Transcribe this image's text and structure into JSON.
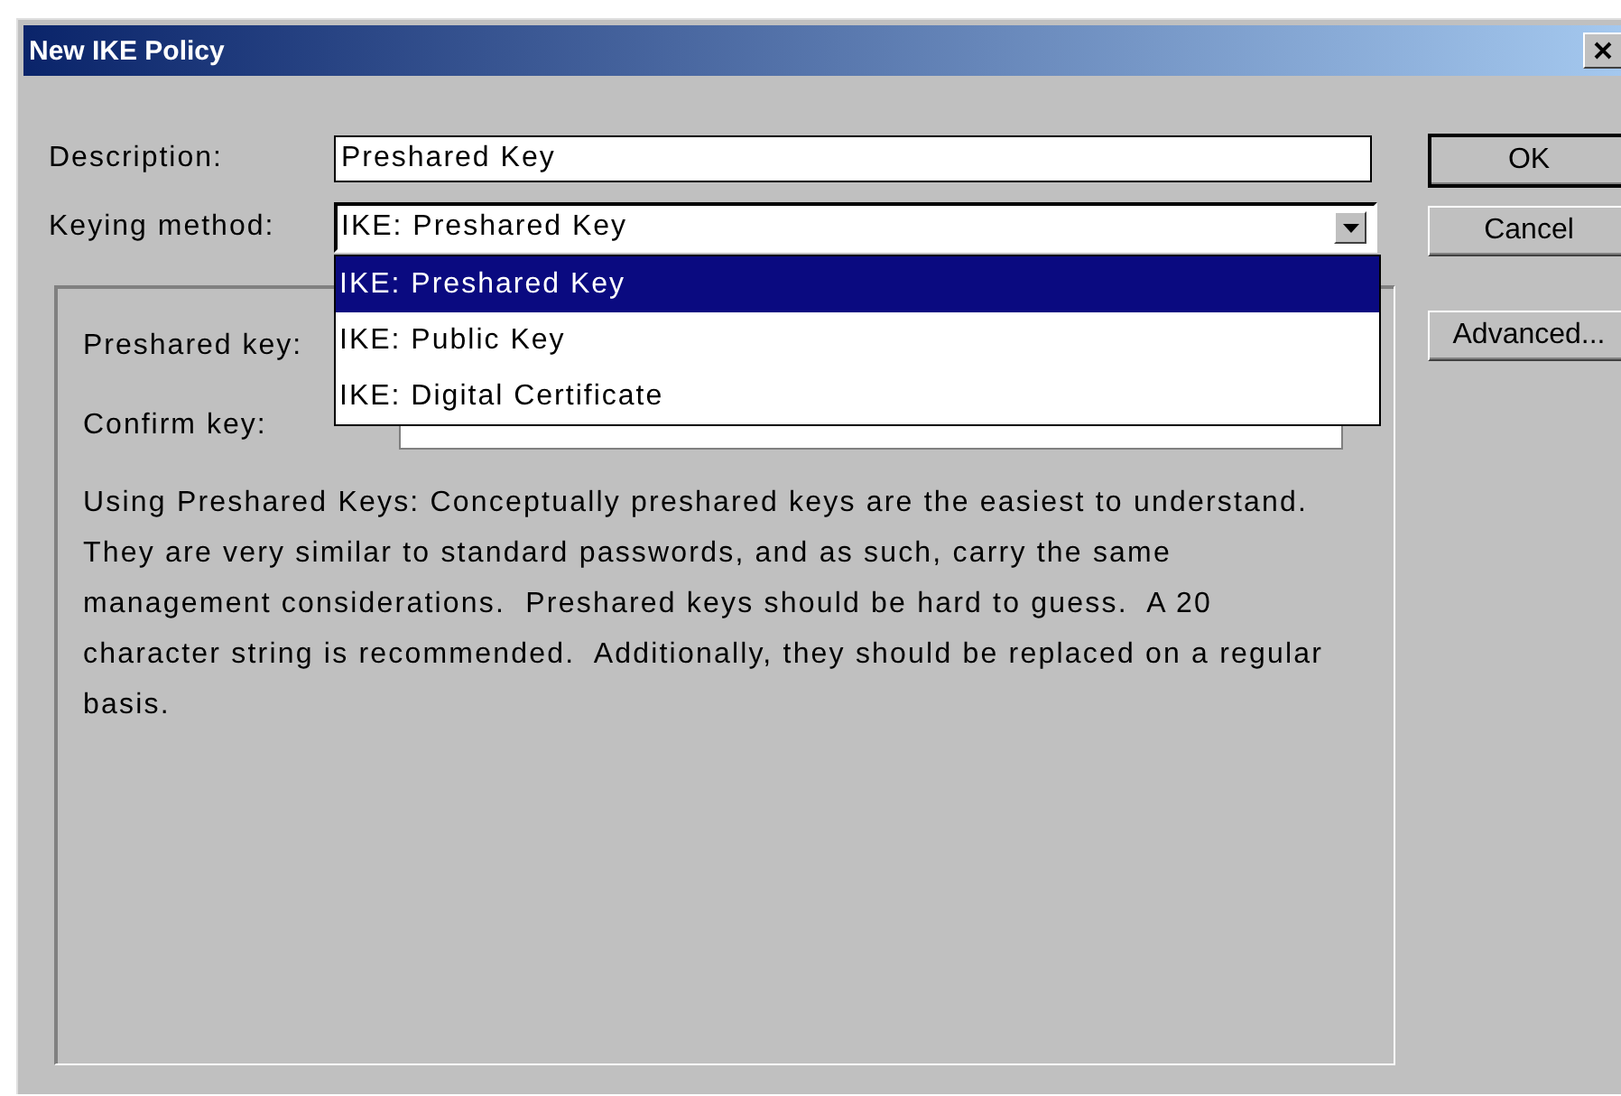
{
  "window": {
    "title": "New IKE Policy"
  },
  "description": {
    "label": "Description:",
    "value": "Preshared Key"
  },
  "keying_method": {
    "label": "Keying method:",
    "value": "IKE: Preshared Key",
    "expanded": true,
    "options": [
      {
        "label": "IKE: Preshared Key",
        "selected": true
      },
      {
        "label": "IKE: Public Key",
        "selected": false
      },
      {
        "label": "IKE: Digital Certificate",
        "selected": false
      }
    ]
  },
  "panel": {
    "preshared_key": {
      "label": "Preshared key:"
    },
    "confirm_key": {
      "label": "Confirm key:"
    },
    "text": "Using Preshared Keys: Conceptually preshared keys are the easiest to understand. They are very similar to standard passwords, and as such, carry the same management considerations.  Preshared keys should be hard to guess.  A 20 character string is recommended.  Additionally, they should be replaced on a regular basis."
  },
  "buttons": [
    {
      "label": "OK",
      "default": true
    },
    {
      "label": "Cancel",
      "default": false
    },
    {
      "label": "Advanced...",
      "default": false
    }
  ]
}
